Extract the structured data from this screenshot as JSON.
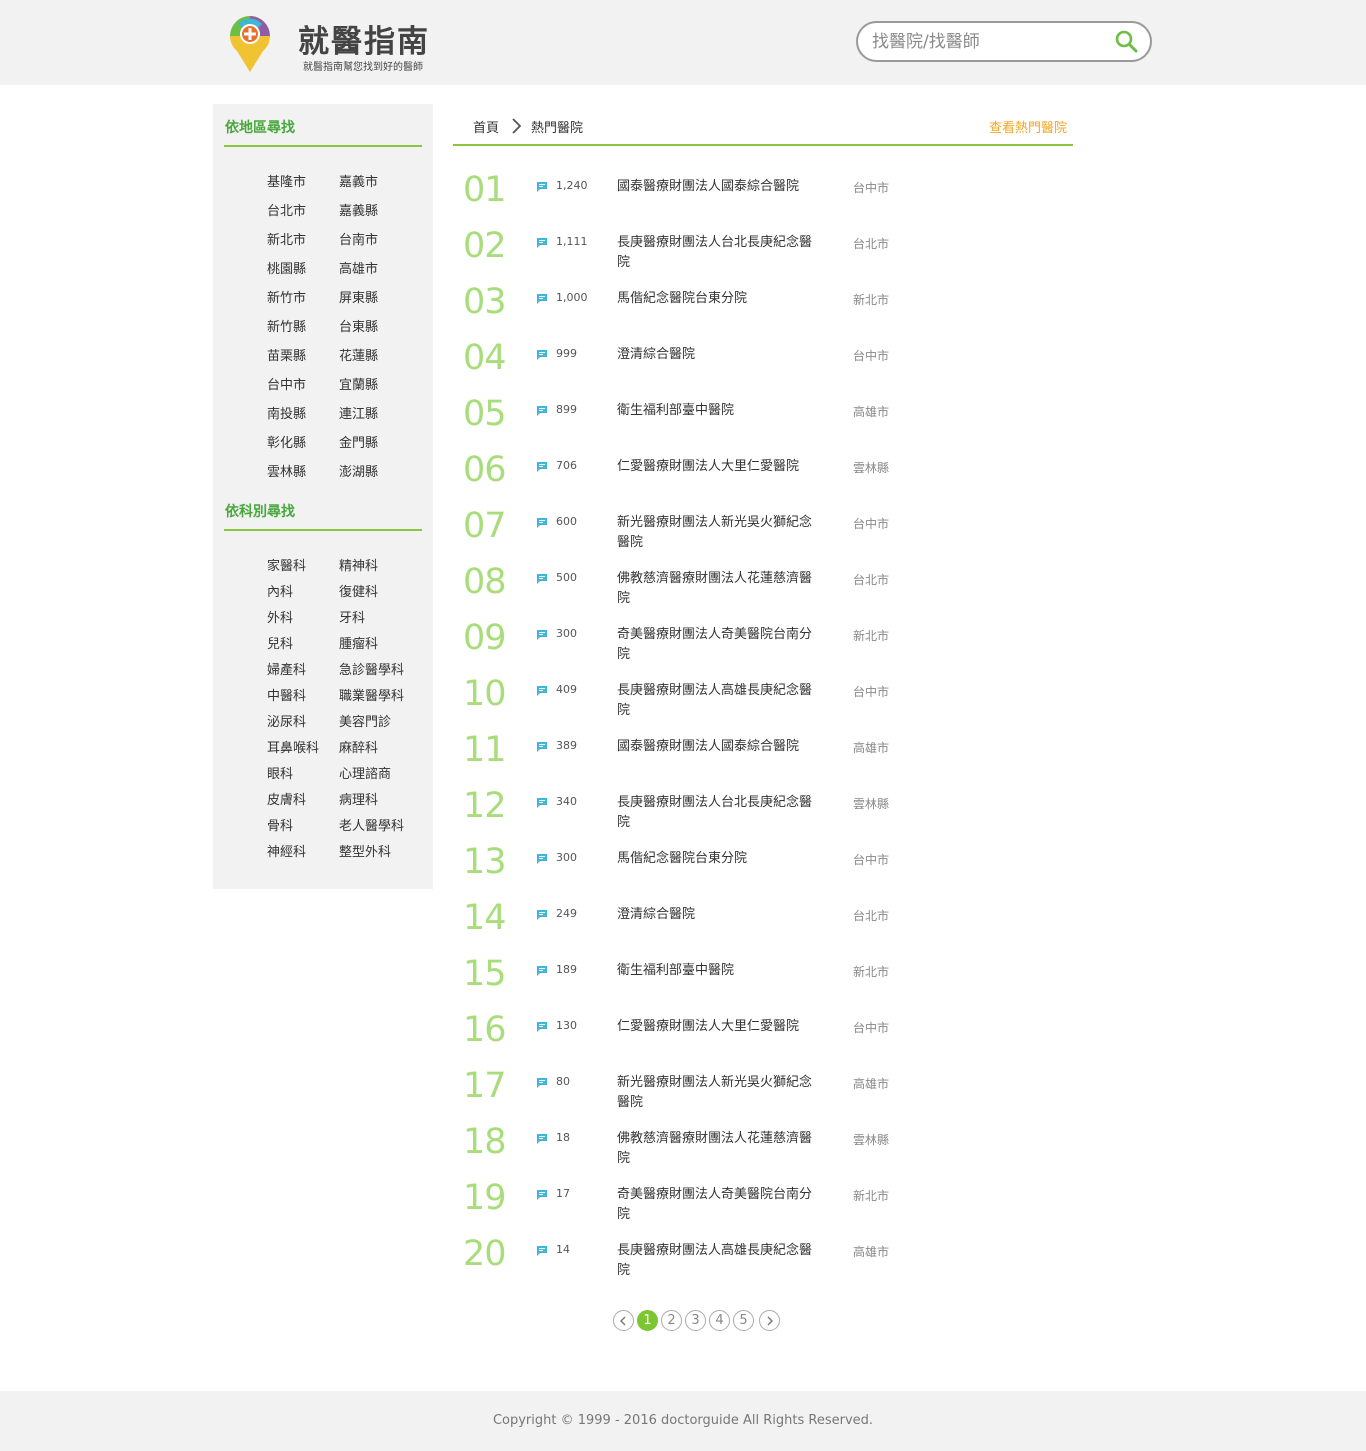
{
  "header": {
    "logo_title": "就醫指南",
    "logo_subtitle": "就醫指南幫您找到好的醫師",
    "search_placeholder": "找醫院/找醫師"
  },
  "sidebar": {
    "region_title": "依地區尋找",
    "regions": [
      "基隆市",
      "嘉義市",
      "台北市",
      "嘉義縣",
      "新北市",
      "台南市",
      "桃園縣",
      "高雄市",
      "新竹市",
      "屏東縣",
      "新竹縣",
      "台東縣",
      "苗栗縣",
      "花蓮縣",
      "台中市",
      "宜蘭縣",
      "南投縣",
      "連江縣",
      "彰化縣",
      "金門縣",
      "雲林縣",
      "澎湖縣"
    ],
    "dept_title": "依科別尋找",
    "departments": [
      "家醫科",
      "精神科",
      "內科",
      "復健科",
      "外科",
      "牙科",
      "兒科",
      "腫瘤科",
      "婦產科",
      "急診醫學科",
      "中醫科",
      "職業醫學科",
      "泌尿科",
      "美容門診",
      "耳鼻喉科",
      "麻醉科",
      "眼科",
      "心理諮商",
      "皮膚科",
      "病理科",
      "骨科",
      "老人醫學科",
      "神經科",
      "整型外科"
    ]
  },
  "breadcrumb": {
    "home": "首頁",
    "current": "熱門醫院"
  },
  "view_hot_link": "查看熱門醫院",
  "hospitals": [
    {
      "rank": "01",
      "count": "1,240",
      "name": "國泰醫療財團法人國泰綜合醫院",
      "city": "台中市"
    },
    {
      "rank": "02",
      "count": "1,111",
      "name": "長庚醫療財團法人台北長庚紀念醫院",
      "city": "台北市"
    },
    {
      "rank": "03",
      "count": "1,000",
      "name": "馬偕紀念醫院台東分院",
      "city": "新北市"
    },
    {
      "rank": "04",
      "count": "999",
      "name": "澄清綜合醫院",
      "city": "台中市"
    },
    {
      "rank": "05",
      "count": "899",
      "name": "衛生福利部臺中醫院",
      "city": "高雄市"
    },
    {
      "rank": "06",
      "count": "706",
      "name": "仁愛醫療財團法人大里仁愛醫院",
      "city": "雲林縣"
    },
    {
      "rank": "07",
      "count": "600",
      "name": "新光醫療財團法人新光吳火獅紀念醫院",
      "city": "台中市"
    },
    {
      "rank": "08",
      "count": "500",
      "name": "佛教慈濟醫療財團法人花蓮慈濟醫院",
      "city": "台北市"
    },
    {
      "rank": "09",
      "count": "300",
      "name": "奇美醫療財團法人奇美醫院台南分院",
      "city": "新北市"
    },
    {
      "rank": "10",
      "count": "409",
      "name": "長庚醫療財團法人高雄長庚紀念醫院",
      "city": "台中市"
    },
    {
      "rank": "11",
      "count": "389",
      "name": "國泰醫療財團法人國泰綜合醫院",
      "city": "高雄市"
    },
    {
      "rank": "12",
      "count": "340",
      "name": "長庚醫療財團法人台北長庚紀念醫院",
      "city": "雲林縣"
    },
    {
      "rank": "13",
      "count": "300",
      "name": "馬偕紀念醫院台東分院",
      "city": "台中市"
    },
    {
      "rank": "14",
      "count": "249",
      "name": "澄清綜合醫院",
      "city": "台北市"
    },
    {
      "rank": "15",
      "count": "189",
      "name": "衛生福利部臺中醫院",
      "city": "新北市"
    },
    {
      "rank": "16",
      "count": "130",
      "name": "仁愛醫療財團法人大里仁愛醫院",
      "city": "台中市"
    },
    {
      "rank": "17",
      "count": "80",
      "name": "新光醫療財團法人新光吳火獅紀念醫院",
      "city": "高雄市"
    },
    {
      "rank": "18",
      "count": "18",
      "name": "佛教慈濟醫療財團法人花蓮慈濟醫院",
      "city": "雲林縣"
    },
    {
      "rank": "19",
      "count": "17",
      "name": "奇美醫療財團法人奇美醫院台南分院",
      "city": "新北市"
    },
    {
      "rank": "20",
      "count": "14",
      "name": "長庚醫療財團法人高雄長庚紀念醫院",
      "city": "高雄市"
    }
  ],
  "pagination": {
    "pages": [
      "1",
      "2",
      "3",
      "4",
      "5"
    ],
    "current": "1"
  },
  "footer": {
    "copyright": "Copyright © 1999 - 2016 doctorguide All Rights Reserved."
  },
  "colors": {
    "accent_green": "#8cc63f",
    "rank_green": "#a9dd7b",
    "link_orange": "#f5a623",
    "comment_icon": "#3fb7d3"
  }
}
